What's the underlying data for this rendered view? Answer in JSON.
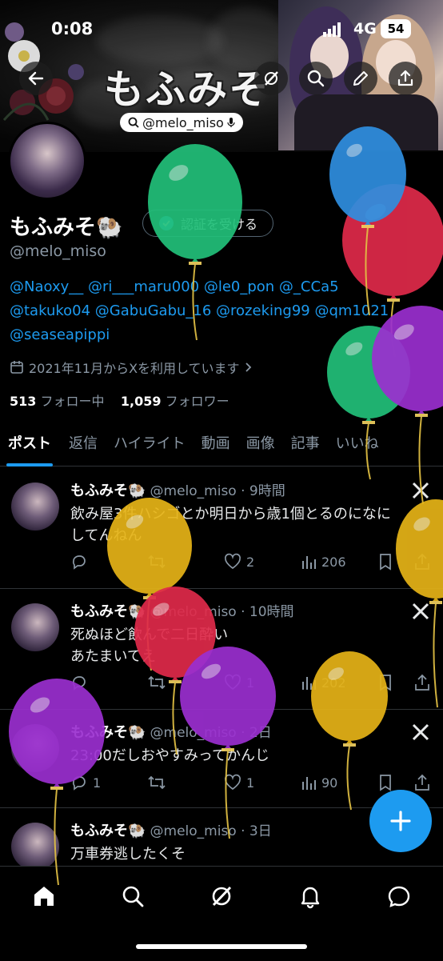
{
  "status_bar": {
    "time": "0:08",
    "network": "4G",
    "battery": "54"
  },
  "header": {
    "logo_text": "もふみそ",
    "handle_pill": "@melo_miso"
  },
  "profile": {
    "name": "もふみそ🐏",
    "verify_button": "認証を受ける",
    "handle": "@melo_miso",
    "bio_line1": "@Naoxy__ @ri___maru000 @le0_pon @_CCa5",
    "bio_line2": "@takuko04 @GabuGabu_16 @rozeking99 @qm1021",
    "bio_line3": "@seaseapippi",
    "joined": "2021年11月からXを利用しています",
    "following_count": "513",
    "following_label": "フォロー中",
    "followers_count": "1,059",
    "followers_label": "フォロワー"
  },
  "tabs": [
    "ポスト",
    "返信",
    "ハイライト",
    "動画",
    "画像",
    "記事",
    "いいね"
  ],
  "posts": [
    {
      "name": "もふみそ🐏",
      "meta": "@melo_miso · 9時間",
      "line1": "飲み屋3件ハシゴとか明日から歳1個とるのになに",
      "line2": "してんねん",
      "replies": "",
      "retweets": "",
      "likes": "2",
      "views": "206"
    },
    {
      "name": "もふみそ🐏",
      "meta": "@melo_miso · 10時間",
      "line1": "死ぬほど飲んで二日酔い",
      "line2": "あたまいてえ",
      "replies": "",
      "retweets": "",
      "likes": "1",
      "views": "202"
    },
    {
      "name": "もふみそ🐏",
      "meta": "@melo_miso · 2日",
      "line1": "23:00だしおやすみってかんじ",
      "line2": "",
      "replies": "1",
      "retweets": "",
      "likes": "1",
      "views": "90"
    },
    {
      "name": "もふみそ🐏",
      "meta": "@melo_miso · 3日",
      "line1": "万車券逃したくそ",
      "line2": ""
    }
  ],
  "colors": {
    "accent": "#1d9bf0",
    "background": "#000000",
    "muted": "#8b98a5",
    "divider": "#2f3336"
  },
  "balloon_colors": {
    "green": "#22c07a",
    "blue": "#2f8fe0",
    "red": "#e02a4a",
    "purple": "#9b2fd0",
    "yellow": "#e6b417"
  },
  "icons": [
    "back-icon",
    "grok-icon",
    "search-icon",
    "edit-icon",
    "share-icon",
    "calendar-icon",
    "chevron-right-icon",
    "reply-icon",
    "retweet-icon",
    "like-icon",
    "views-icon",
    "bookmark-icon",
    "x-logo-icon",
    "plus-icon",
    "home-icon",
    "notifications-icon",
    "messages-icon"
  ]
}
